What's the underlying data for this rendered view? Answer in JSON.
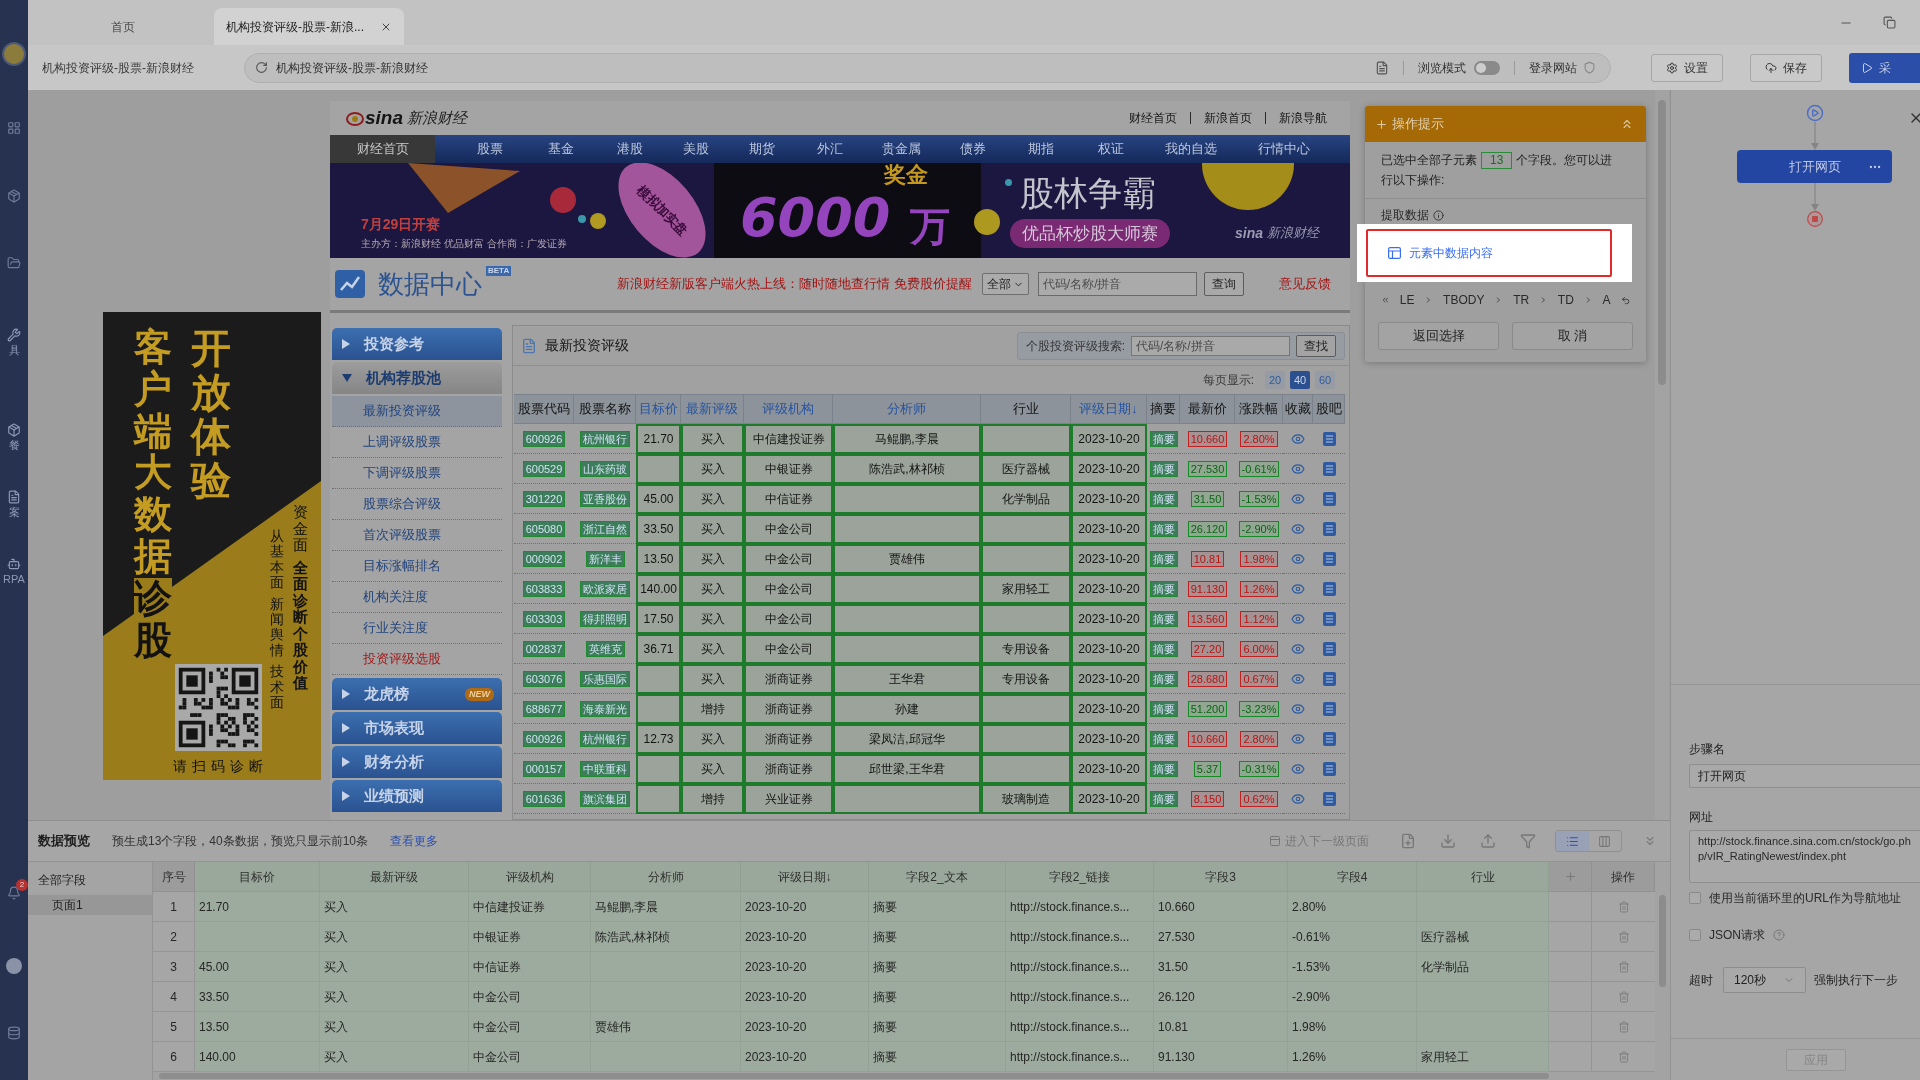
{
  "browser": {
    "tabs": [
      {
        "label": "首页",
        "selected": false
      },
      {
        "label": "机构投资评级-股票-新浪...",
        "selected": true
      }
    ],
    "page_title": "机构投资评级-股票-新浪财经",
    "address": "机构投资评级-股票-新浪财经",
    "browse_mode": {
      "label": "浏览模式",
      "on": false
    },
    "login": "登录网站",
    "buttons": [
      {
        "label": "设置",
        "kind": "settings"
      },
      {
        "label": "保存",
        "kind": "save"
      },
      {
        "label": "采",
        "kind": "run"
      }
    ]
  },
  "rail": {
    "items": [
      {
        "label": "具"
      },
      {
        "label": "餐"
      },
      {
        "label": "案"
      },
      {
        "label": "RPA"
      }
    ],
    "badge": "2"
  },
  "sina": {
    "logo_mark": "sina",
    "logo_text": "新浪财经",
    "links": [
      "财经首页",
      "新浪首页",
      "新浪导航"
    ],
    "nav": [
      {
        "label": "财经首页",
        "selected": true
      },
      {
        "label": "股票",
        "selected": false
      },
      {
        "label": "基金",
        "selected": false
      },
      {
        "label": "港股",
        "selected": false
      },
      {
        "label": "美股",
        "selected": false
      },
      {
        "label": "期货",
        "selected": false
      },
      {
        "label": "外汇",
        "selected": false
      },
      {
        "label": "贵金属",
        "selected": false
      },
      {
        "label": "债券",
        "selected": false
      },
      {
        "label": "期指",
        "selected": false
      },
      {
        "label": "权证",
        "selected": false
      },
      {
        "label": "我的自选",
        "selected": false
      },
      {
        "label": "行情中心",
        "selected": false
      }
    ],
    "banner": {
      "date": "7月29日开赛",
      "sponsors": "主办方：新浪财经 优品财富 合作商：广发证券",
      "ribbon": "模拟加实盘",
      "prize_amount": "6000",
      "prize_unit": "万",
      "prize_label": "奖金",
      "title": "股林争霸",
      "subtitle": "优品杯炒股大师赛",
      "brand_mark": "sina",
      "brand": "新浪财经"
    }
  },
  "data_center": {
    "title": "数据中心",
    "badge": "BETA",
    "promo": "新浪财经新版客户端火热上线：随时随地查行情 免费股价提醒",
    "scope": "全部",
    "search_placeholder": "代码/名称/拼音",
    "search_button": "查询",
    "feedback": "意见反馈"
  },
  "ad": {
    "headline_1": "开放体验",
    "headline_2": "客户端大数据",
    "headline_3": "诊股",
    "column_1": [
      {
        "text": "资金面",
        "bold": false
      },
      {
        "text": "全面诊断个股价值",
        "bold": true
      }
    ],
    "column_2": [
      "从基本面",
      "新闻舆情",
      "技术面"
    ],
    "qr_caption": "请扫码诊断"
  },
  "menu": [
    {
      "label": "投资参考",
      "expanded": false
    },
    {
      "label": "机构荐股池",
      "expanded": true,
      "children": [
        {
          "label": "最新投资评级",
          "selected": true,
          "promoted": false
        },
        {
          "label": "上调评级股票",
          "selected": false,
          "promoted": false
        },
        {
          "label": "下调评级股票",
          "selected": false,
          "promoted": false
        },
        {
          "label": "股票综合评级",
          "selected": false,
          "promoted": false
        },
        {
          "label": "首次评级股票",
          "selected": false,
          "promoted": false
        },
        {
          "label": "目标涨幅排名",
          "selected": false,
          "promoted": false
        },
        {
          "label": "机构关注度",
          "selected": false,
          "promoted": false
        },
        {
          "label": "行业关注度",
          "selected": false,
          "promoted": false
        },
        {
          "label": "投资评级选股",
          "selected": false,
          "promoted": true
        }
      ]
    },
    {
      "label": "龙虎榜",
      "expanded": false,
      "badge": "NEW"
    },
    {
      "label": "市场表现",
      "expanded": false
    },
    {
      "label": "财务分析",
      "expanded": false
    },
    {
      "label": "业绩预测",
      "expanded": false
    }
  ],
  "ratings": {
    "title": "最新投资评级",
    "search_label": "个股投资评级搜索:",
    "search_placeholder": "代码/名称/拼音",
    "search_button": "查找",
    "page_size_label": "每页显示:",
    "page_sizes": [
      {
        "label": "20",
        "selected": false
      },
      {
        "label": "40",
        "selected": true
      },
      {
        "label": "60",
        "selected": false
      }
    ],
    "columns": [
      {
        "label": "股票代码",
        "kind": "link",
        "sortable": false,
        "highlighted": false
      },
      {
        "label": "股票名称",
        "kind": "link",
        "sortable": false,
        "highlighted": false
      },
      {
        "label": "目标价",
        "kind": "text",
        "sortable": true,
        "highlighted": true
      },
      {
        "label": "最新评级",
        "kind": "text",
        "sortable": true,
        "highlighted": true
      },
      {
        "label": "评级机构",
        "kind": "text",
        "sortable": true,
        "highlighted": true
      },
      {
        "label": "分析师",
        "kind": "text",
        "sortable": true,
        "highlighted": true
      },
      {
        "label": "行业",
        "kind": "text",
        "sortable": false,
        "highlighted": true
      },
      {
        "label": "评级日期↓",
        "kind": "text",
        "sortable": true,
        "highlighted": true
      },
      {
        "label": "摘要",
        "kind": "link",
        "sortable": false,
        "highlighted": false
      },
      {
        "label": "最新价",
        "kind": "quote",
        "sortable": false,
        "highlighted": false
      },
      {
        "label": "涨跌幅",
        "kind": "quote",
        "sortable": false,
        "highlighted": false
      },
      {
        "label": "收藏",
        "kind": "favorite",
        "sortable": false,
        "highlighted": false
      },
      {
        "label": "股吧",
        "kind": "forum",
        "sortable": false,
        "highlighted": false
      }
    ],
    "rows": [
      {
        "code": "600926",
        "name": "杭州银行",
        "target": "21.70",
        "rating": "买入",
        "institution": "中信建投证券",
        "analyst": "马鲲鹏,李晨",
        "date": "2023-10-20",
        "summary": "摘要",
        "price": "10.660",
        "change": "2.80%",
        "rising": true
      },
      {
        "code": "600529",
        "name": "山东药玻",
        "rating": "买入",
        "institution": "中银证券",
        "analyst": "陈浩武,林祁桢",
        "industry": "医疗器械",
        "date": "2023-10-20",
        "summary": "摘要",
        "price": "27.530",
        "change": "-0.61%",
        "rising": false
      },
      {
        "code": "301220",
        "name": "亚香股份",
        "target": "45.00",
        "rating": "买入",
        "institution": "中信证券",
        "industry": "化学制品",
        "date": "2023-10-20",
        "summary": "摘要",
        "price": "31.50",
        "change": "-1.53%",
        "rising": false
      },
      {
        "code": "605080",
        "name": "浙江自然",
        "target": "33.50",
        "rating": "买入",
        "institution": "中金公司",
        "date": "2023-10-20",
        "summary": "摘要",
        "price": "26.120",
        "change": "-2.90%",
        "rising": false
      },
      {
        "code": "000902",
        "name": "新洋丰",
        "target": "13.50",
        "rating": "买入",
        "institution": "中金公司",
        "analyst": "贾雄伟",
        "date": "2023-10-20",
        "summary": "摘要",
        "price": "10.81",
        "change": "1.98%",
        "rising": true
      },
      {
        "code": "603833",
        "name": "欧派家居",
        "target": "140.00",
        "rating": "买入",
        "institution": "中金公司",
        "industry": "家用轻工",
        "date": "2023-10-20",
        "summary": "摘要",
        "price": "91.130",
        "change": "1.26%",
        "rising": true
      },
      {
        "code": "603303",
        "name": "得邦照明",
        "target": "17.50",
        "rating": "买入",
        "institution": "中金公司",
        "date": "2023-10-20",
        "summary": "摘要",
        "price": "13.560",
        "change": "1.12%",
        "rising": true
      },
      {
        "code": "002837",
        "name": "英维克",
        "target": "36.71",
        "rating": "买入",
        "institution": "中金公司",
        "industry": "专用设备",
        "date": "2023-10-20",
        "summary": "摘要",
        "price": "27.20",
        "change": "6.00%",
        "rising": true
      },
      {
        "code": "603076",
        "name": "乐惠国际",
        "rating": "买入",
        "institution": "浙商证券",
        "analyst": "王华君",
        "industry": "专用设备",
        "date": "2023-10-20",
        "summary": "摘要",
        "price": "28.680",
        "change": "0.67%",
        "rising": true
      },
      {
        "code": "688677",
        "name": "海泰新光",
        "rating": "增持",
        "institution": "浙商证券",
        "analyst": "孙建",
        "date": "2023-10-20",
        "summary": "摘要",
        "price": "51.200",
        "change": "-3.23%",
        "rising": false
      },
      {
        "code": "600926",
        "name": "杭州银行",
        "target": "12.73",
        "rating": "买入",
        "institution": "浙商证券",
        "analyst": "梁凤洁,邱冠华",
        "date": "2023-10-20",
        "summary": "摘要",
        "price": "10.660",
        "change": "2.80%",
        "rising": true
      },
      {
        "code": "000157",
        "name": "中联重科",
        "rating": "买入",
        "institution": "浙商证券",
        "analyst": "邱世梁,王华君",
        "date": "2023-10-20",
        "summary": "摘要",
        "price": "5.37",
        "change": "-0.31%",
        "rising": false
      },
      {
        "code": "601636",
        "name": "旗滨集团",
        "rating": "增持",
        "institution": "兴业证券",
        "industry": "玻璃制造",
        "date": "2023-10-20",
        "summary": "摘要",
        "price": "8.150",
        "change": "0.62%",
        "rising": true
      }
    ]
  },
  "hint": {
    "title": "操作提示",
    "message_before": "已选中全部子元素",
    "count": "13",
    "message_after": "个字段。您可以进行以下操作:",
    "section": "提取数据",
    "action": "元素中数据内容",
    "path": [
      "LE",
      "TBODY",
      "TR",
      "TD",
      "A"
    ],
    "buttons": [
      "返回选择",
      "取 消"
    ]
  },
  "flow": {
    "nodes": [
      {
        "kind": "start"
      },
      {
        "kind": "step",
        "label": "打开网页"
      },
      {
        "kind": "end"
      }
    ]
  },
  "step_form": {
    "name_label": "步骤名",
    "name": "打开网页",
    "url_label": "网址",
    "url": "http://stock.finance.sina.com.cn/stock/go.php/vIR_RatingNewest/index.pht",
    "options": [
      {
        "label": "使用当前循环里的URL作为导航地址",
        "checked": false,
        "help": false
      },
      {
        "label": "JSON请求",
        "checked": false,
        "help": true
      }
    ],
    "timeout_label": "超时",
    "timeout": "120秒",
    "timeout_action": "强制执行下一步",
    "apply": "应用"
  },
  "preview": {
    "title": "数据预览",
    "summary": "预生成13个字段，40条数据，预览只显示前10条",
    "more": "查看更多",
    "next_level": "进入下一级页面",
    "views": [
      {
        "kind": "list",
        "selected": true
      },
      {
        "kind": "columns",
        "selected": false
      }
    ],
    "field_tree": {
      "label": "全部字段",
      "children": [
        {
          "label": "页面1",
          "selected": true
        }
      ]
    },
    "columns": [
      {
        "kind": "index",
        "label": "序号"
      },
      {
        "kind": "field",
        "label": "目标价"
      },
      {
        "kind": "field",
        "label": "最新评级"
      },
      {
        "kind": "field",
        "label": "评级机构"
      },
      {
        "kind": "field",
        "label": "分析师"
      },
      {
        "kind": "field",
        "label": "评级日期↓"
      },
      {
        "kind": "field",
        "label": "字段2_文本"
      },
      {
        "kind": "field",
        "label": "字段2_链接"
      },
      {
        "kind": "field",
        "label": "字段3"
      },
      {
        "kind": "field",
        "label": "字段4"
      },
      {
        "kind": "field",
        "label": "行业"
      },
      {
        "kind": "add"
      },
      {
        "kind": "actions",
        "label": "操作"
      }
    ],
    "rows": [
      {
        "no": "1",
        "target": "21.70",
        "rating": "买入",
        "institution": "中信建投证券",
        "analyst": "马鲲鹏,李晨",
        "date": "2023-10-20",
        "text": "摘要",
        "link": "http://stock.finance.s...",
        "field3": "10.660",
        "field4": "2.80%"
      },
      {
        "no": "2",
        "rating": "买入",
        "institution": "中银证券",
        "analyst": "陈浩武,林祁桢",
        "date": "2023-10-20",
        "text": "摘要",
        "link": "http://stock.finance.s...",
        "field3": "27.530",
        "field4": "-0.61%",
        "industry": "医疗器械"
      },
      {
        "no": "3",
        "target": "45.00",
        "rating": "买入",
        "institution": "中信证券",
        "date": "2023-10-20",
        "text": "摘要",
        "link": "http://stock.finance.s...",
        "field3": "31.50",
        "field4": "-1.53%",
        "industry": "化学制品"
      },
      {
        "no": "4",
        "target": "33.50",
        "rating": "买入",
        "institution": "中金公司",
        "date": "2023-10-20",
        "text": "摘要",
        "link": "http://stock.finance.s...",
        "field3": "26.120",
        "field4": "-2.90%"
      },
      {
        "no": "5",
        "target": "13.50",
        "rating": "买入",
        "institution": "中金公司",
        "analyst": "贾雄伟",
        "date": "2023-10-20",
        "text": "摘要",
        "link": "http://stock.finance.s...",
        "field3": "10.81",
        "field4": "1.98%"
      },
      {
        "no": "6",
        "target": "140.00",
        "rating": "买入",
        "institution": "中金公司",
        "date": "2023-10-20",
        "text": "摘要",
        "link": "http://stock.finance.s...",
        "field3": "91.130",
        "field4": "1.26%",
        "industry": "家用轻工"
      }
    ]
  }
}
